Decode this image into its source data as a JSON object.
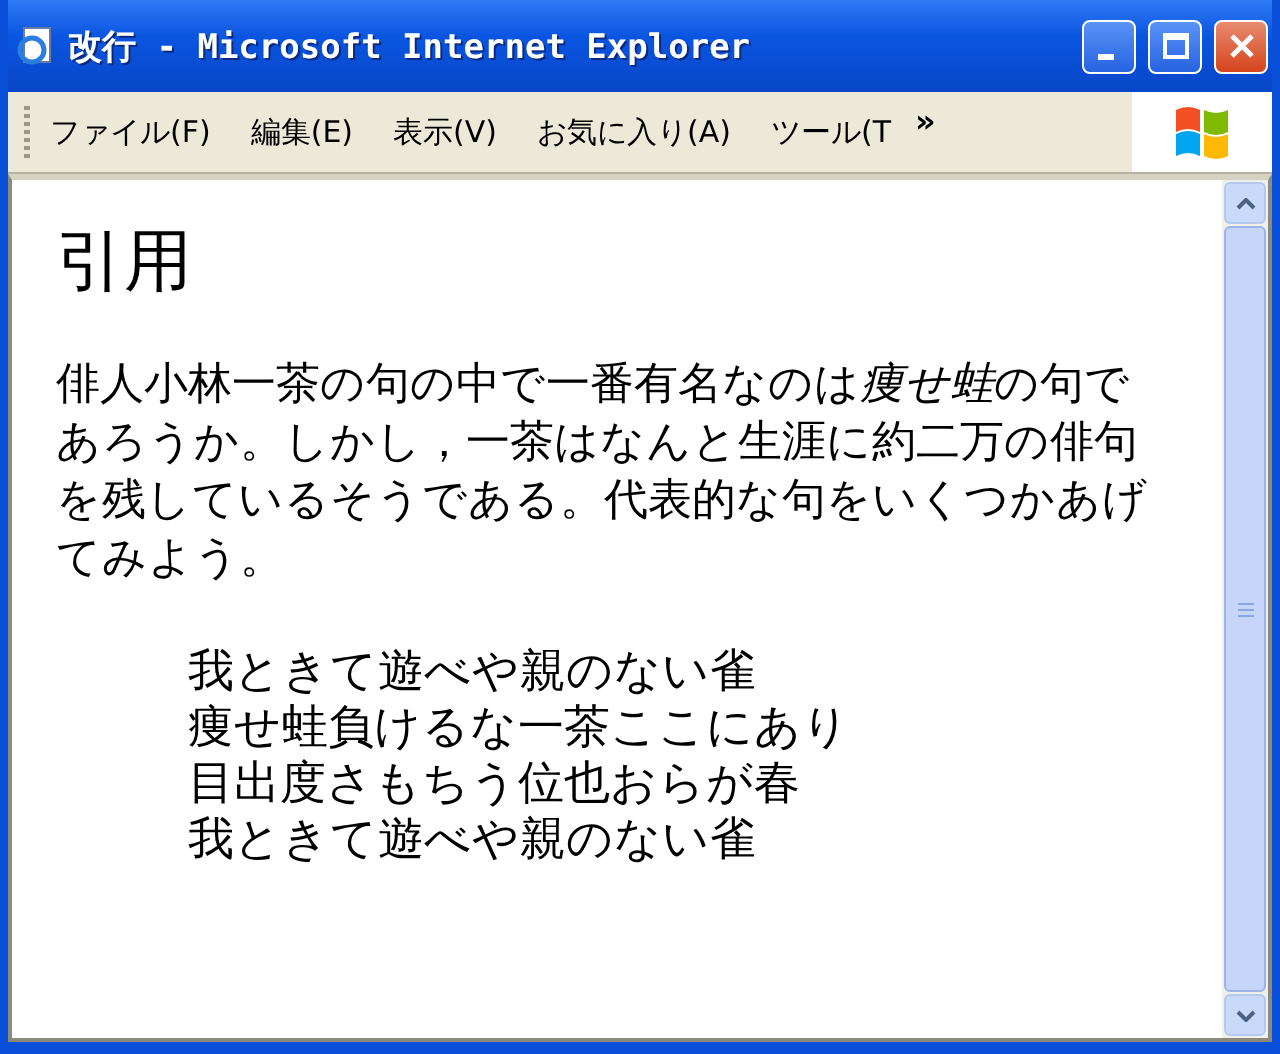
{
  "window": {
    "title": "改行 - Microsoft Internet Explorer"
  },
  "menu": [
    "ファイル(F)",
    "編集(E)",
    "表示(V)",
    "お気に入り(A)",
    "ツール(T"
  ],
  "menu_more": "»",
  "page": {
    "heading": "引用",
    "paragraph": [
      {
        "text": "俳人小林一茶の句の中で一番有名なのは",
        "italic": false
      },
      {
        "text": "痩せ蛙",
        "italic": true
      },
      {
        "text": "の句であろうか。しかし，一茶はなんと生涯に約二万の俳句を残しているそうである。代表的な句をいくつかあげてみよう。",
        "italic": false
      }
    ],
    "quote": [
      "我ときて遊べや親のない雀",
      "痩せ蛙負けるな一茶ここにあり",
      "目出度さもちう位也おらが春",
      "我ときて遊べや親のない雀"
    ]
  }
}
